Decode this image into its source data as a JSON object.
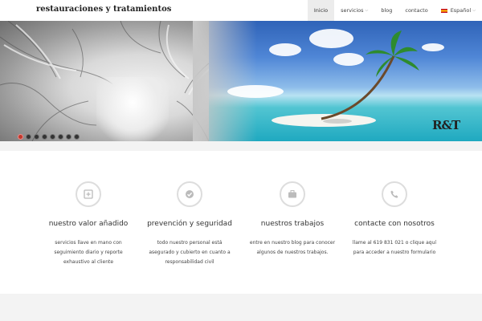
{
  "header": {
    "site_title": "restauraciones y tratamientos"
  },
  "nav": {
    "items": [
      {
        "label": "Inicio"
      },
      {
        "label": "servicios"
      },
      {
        "label": "blog"
      },
      {
        "label": "contacto"
      },
      {
        "label": "Español"
      }
    ]
  },
  "hero": {
    "logo": {
      "r": "R",
      "amp": "&",
      "t": "T"
    },
    "slide_count": 8,
    "active_slide": 1
  },
  "features": [
    {
      "icon": "plus-square-icon",
      "title": "nuestro valor añadido",
      "lines": [
        "servicios llave en mano con",
        "seguimiento diario y reporte",
        "exhaustivo al cliente"
      ]
    },
    {
      "icon": "check-icon",
      "title": "prevención y seguridad",
      "lines": [
        "todo nuestro personal está",
        "asegurado y cubierto en cuanto a",
        "responsabilidad civil"
      ]
    },
    {
      "icon": "briefcase-icon",
      "title": "nuestros trabajos",
      "lines": [
        "entre en nuestro blog para conocer",
        "algunos de nuestros trabajos."
      ]
    },
    {
      "icon": "phone-icon",
      "title": "contacte con nosotros",
      "lines": [
        "llame al 619 831 021 o clique aquí",
        "para acceder a nuestro formulario"
      ]
    }
  ]
}
